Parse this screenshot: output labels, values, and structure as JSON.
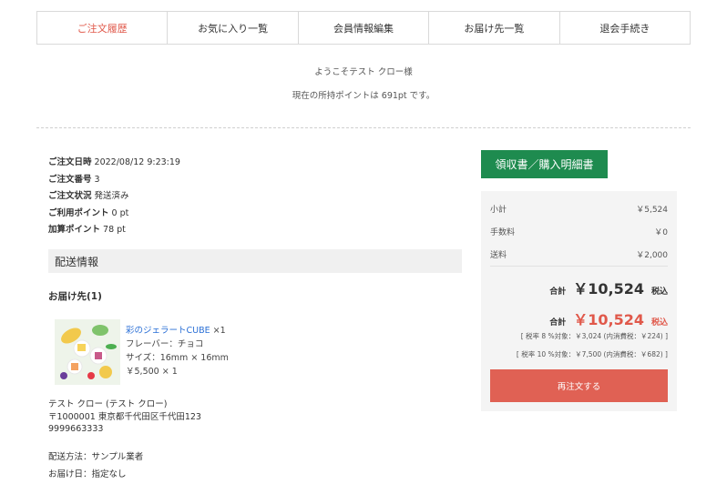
{
  "tabs": [
    {
      "label": "ご注文履歴",
      "active": true
    },
    {
      "label": "お気に入り一覧",
      "active": false
    },
    {
      "label": "会員情報編集",
      "active": false
    },
    {
      "label": "お届け先一覧",
      "active": false
    },
    {
      "label": "退会手続き",
      "active": false
    }
  ],
  "welcome": {
    "greeting": "ようこそテスト クロー様",
    "points": "現在の所持ポイントは 691pt です。"
  },
  "order": {
    "date_label": "ご注文日時",
    "date_value": "2022/08/12 9:23:19",
    "number_label": "ご注文番号",
    "number_value": "3",
    "status_label": "ご注文状況",
    "status_value": "発送済み",
    "used_points_label": "ご利用ポイント",
    "used_points_value": "0 pt",
    "added_points_label": "加算ポイント",
    "added_points_value": "78 pt"
  },
  "delivery": {
    "section_title": "配送情報",
    "destination_title": "お届け先(1)",
    "product": {
      "name": "彩のジェラートCUBE",
      "qty": "×1",
      "flavor": "フレーバー：チョコ",
      "size": "サイズ：16mm × 16mm",
      "price": "￥5,500 × 1"
    },
    "address": {
      "name": "テスト クロー (テスト クロー)",
      "postal_address": "〒1000001 東京都千代田区千代田123",
      "phone": "9999663333"
    },
    "method": "配送方法：サンプル業者",
    "date": "お届け日：指定なし"
  },
  "receipt_button": "領収書／購入明細書",
  "summary": {
    "subtotal_label": "小計",
    "subtotal_value": "￥5,524",
    "fee_label": "手数料",
    "fee_value": "￥0",
    "shipping_label": "送料",
    "shipping_value": "￥2,000",
    "total_label": "合計",
    "total_value": "￥10,524",
    "total_tax": "税込",
    "total2_label": "合計",
    "total2_value": "￥10,524",
    "total2_tax": "税込",
    "tax8": "[ 税率 8 %対象：￥3,024 (内消費税：￥224) ]",
    "tax10": "[ 税率 10 %対象：￥7,500 (内消費税：￥682) ]",
    "reorder": "再注文する"
  },
  "colors": {
    "accent_red": "#e0584a",
    "receipt_green": "#1e8b4f",
    "link_blue": "#2a6fd6"
  }
}
